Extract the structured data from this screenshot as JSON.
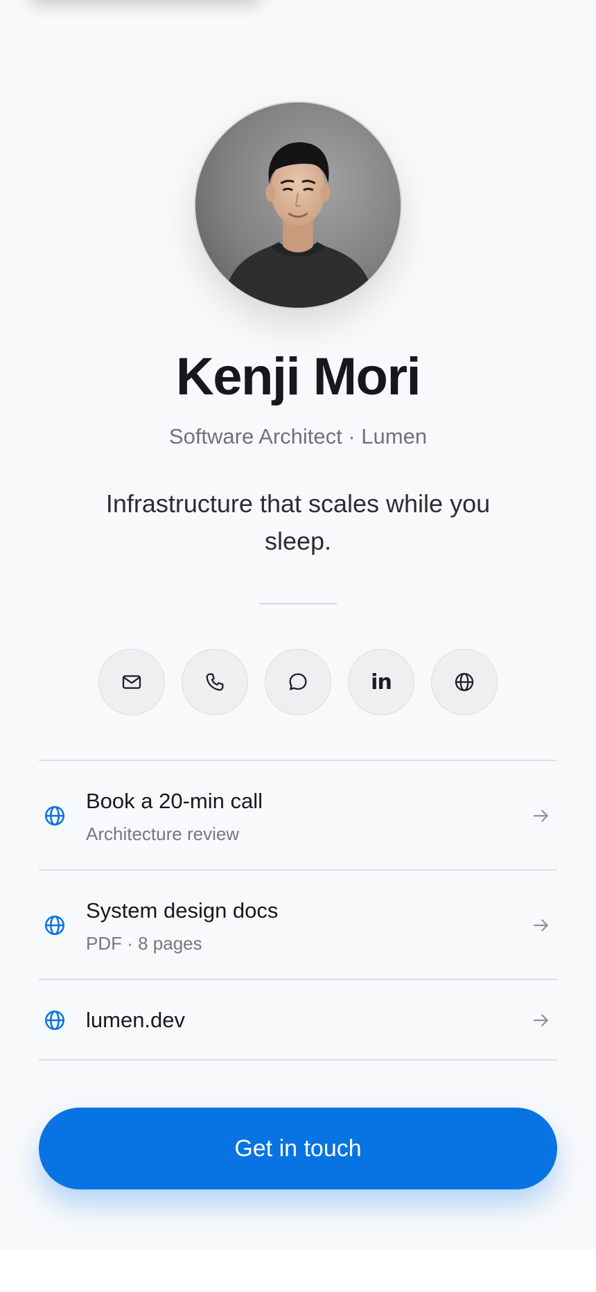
{
  "profile": {
    "name": "Kenji Mori",
    "role": "Software Architect · Lumen",
    "tagline": "Infrastructure that scales while you sleep."
  },
  "socials": [
    {
      "icon": "mail-icon",
      "label": "Email"
    },
    {
      "icon": "phone-icon",
      "label": "Phone"
    },
    {
      "icon": "chat-icon",
      "label": "Message"
    },
    {
      "icon": "linkedin-icon",
      "label": "in"
    },
    {
      "icon": "globe-icon",
      "label": "Website"
    }
  ],
  "links": [
    {
      "title": "Book a 20-min call",
      "subtitle": "Architecture review",
      "icon": "globe-icon"
    },
    {
      "title": "System design docs",
      "subtitle": "PDF · 8 pages",
      "icon": "globe-icon"
    },
    {
      "title": "lumen.dev",
      "icon": "globe-icon"
    }
  ],
  "cta": {
    "label": "Get in touch"
  },
  "colors": {
    "accent": "#0873e2",
    "background": "#f8f9fb",
    "text": "#16181d",
    "muted": "#6f7278"
  }
}
